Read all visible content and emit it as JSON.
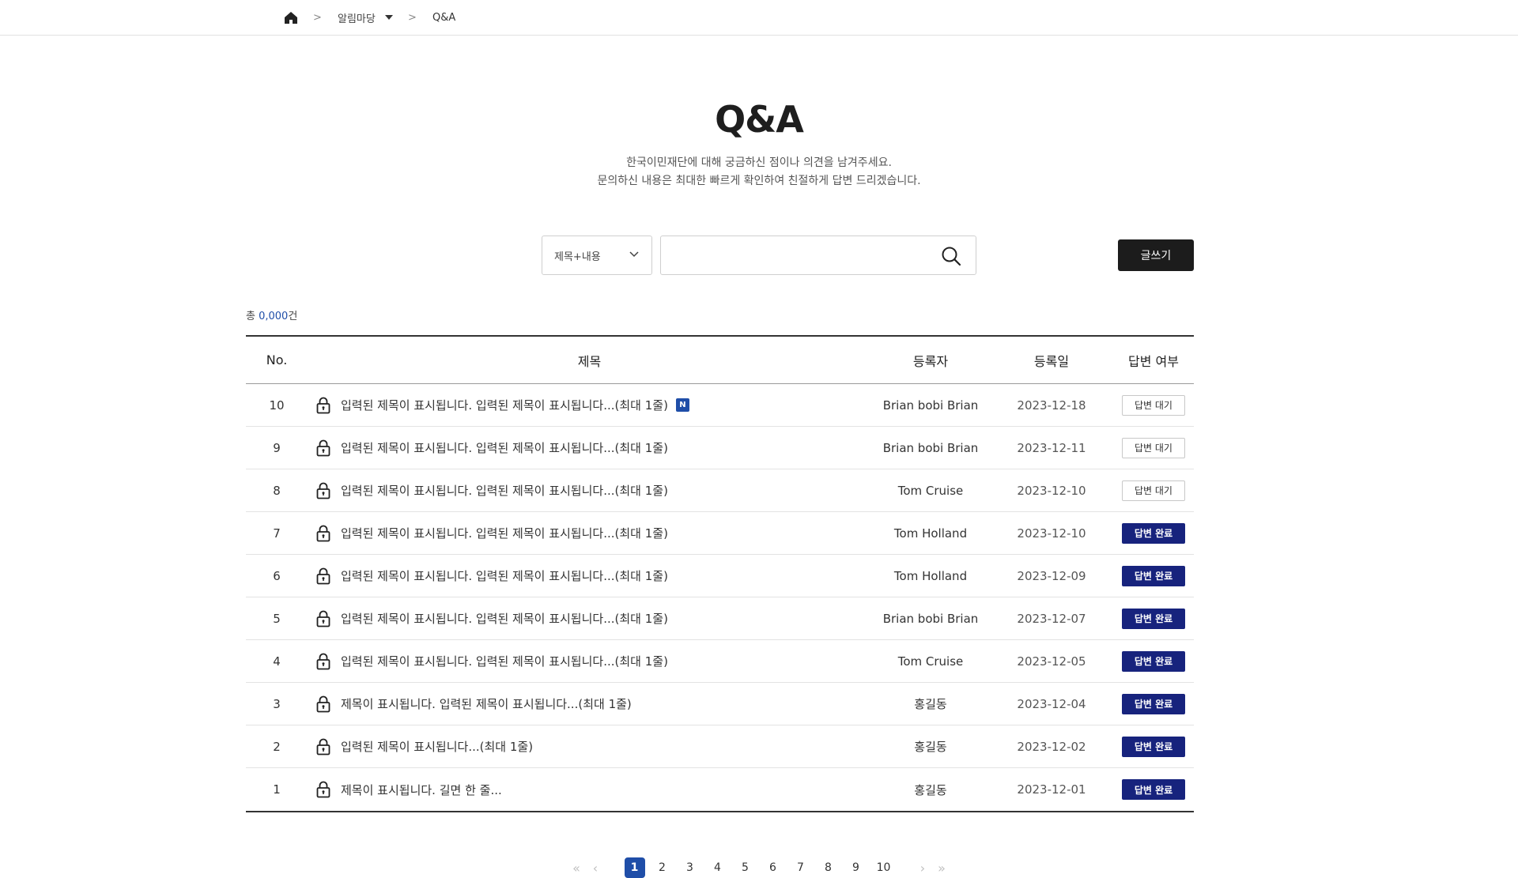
{
  "breadcrumb": {
    "home_icon": "home-icon",
    "separator": ">",
    "menu_label": "알림마당",
    "current": "Q&A"
  },
  "header": {
    "title": "Q&A",
    "description_line1": "한국이민재단에 대해 궁금하신 점이나 의견을 남겨주세요.",
    "description_line2": "문의하신 내용은 최대한 빠르게 확인하여 친절하게 답변 드리겠습니다."
  },
  "search": {
    "select_value": "제목+내용",
    "input_value": "",
    "write_button": "글쓰기"
  },
  "summary": {
    "prefix": "총 ",
    "count": "0,000",
    "suffix": "건"
  },
  "table": {
    "headers": [
      "No.",
      "제목",
      "등록자",
      "등록일",
      "답변 여부"
    ],
    "new_badge": "N",
    "rows": [
      {
        "no": "10",
        "title": "입력된 제목이 표시됩니다. 입력된 제목이 표시됩니다...(최대 1줄)",
        "writer": "Brian bobi Brian",
        "date": "2023-12-18",
        "status": "답변 대기",
        "answered": false,
        "is_new": true
      },
      {
        "no": "9",
        "title": "입력된 제목이 표시됩니다. 입력된 제목이 표시됩니다...(최대 1줄)",
        "writer": "Brian bobi Brian",
        "date": "2023-12-11",
        "status": "답변 대기",
        "answered": false,
        "is_new": false
      },
      {
        "no": "8",
        "title": "입력된 제목이 표시됩니다. 입력된 제목이 표시됩니다...(최대 1줄)",
        "writer": "Tom Cruise",
        "date": "2023-12-10",
        "status": "답변 대기",
        "answered": false,
        "is_new": false
      },
      {
        "no": "7",
        "title": "입력된 제목이 표시됩니다. 입력된 제목이 표시됩니다...(최대 1줄)",
        "writer": "Tom Holland",
        "date": "2023-12-10",
        "status": "답변 완료",
        "answered": true,
        "is_new": false
      },
      {
        "no": "6",
        "title": "입력된 제목이 표시됩니다. 입력된 제목이 표시됩니다...(최대 1줄)",
        "writer": "Tom Holland",
        "date": "2023-12-09",
        "status": "답변 완료",
        "answered": true,
        "is_new": false
      },
      {
        "no": "5",
        "title": "입력된 제목이 표시됩니다. 입력된 제목이 표시됩니다...(최대 1줄)",
        "writer": "Brian bobi Brian",
        "date": "2023-12-07",
        "status": "답변 완료",
        "answered": true,
        "is_new": false
      },
      {
        "no": "4",
        "title": "입력된 제목이 표시됩니다. 입력된 제목이 표시됩니다...(최대 1줄)",
        "writer": "Tom Cruise",
        "date": "2023-12-05",
        "status": "답변 완료",
        "answered": true,
        "is_new": false
      },
      {
        "no": "3",
        "title": "제목이 표시됩니다. 입력된 제목이 표시됩니다...(최대 1줄)",
        "writer": "홍길동",
        "date": "2023-12-04",
        "status": "답변 완료",
        "answered": true,
        "is_new": false
      },
      {
        "no": "2",
        "title": "입력된 제목이 표시됩니다...(최대 1줄)",
        "writer": "홍길동",
        "date": "2023-12-02",
        "status": "답변 완료",
        "answered": true,
        "is_new": false
      },
      {
        "no": "1",
        "title": "제목이 표시됩니다. 길면 한 줄...",
        "writer": "홍길동",
        "date": "2023-12-01",
        "status": "답변 완료",
        "answered": true,
        "is_new": false
      }
    ]
  },
  "pagination": {
    "first": "«",
    "prev": "‹",
    "next": "›",
    "last": "»",
    "pages": [
      "1",
      "2",
      "3",
      "4",
      "5",
      "6",
      "7",
      "8",
      "9",
      "10"
    ],
    "current": "1"
  },
  "colors": {
    "accent": "#1f4ea8",
    "done_badge": "#17237d",
    "write_button": "#1c1c1c"
  }
}
